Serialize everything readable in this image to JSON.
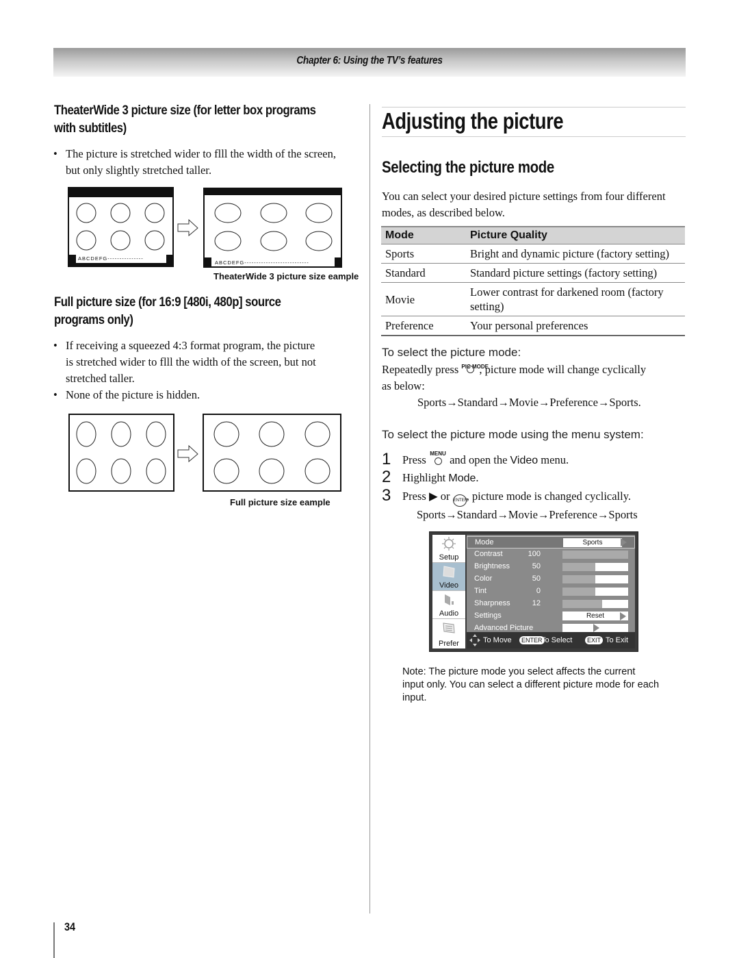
{
  "header": {
    "chapter": "Chapter 6: Using the TV’s features"
  },
  "left": {
    "theaterwide": {
      "heading_line1": "TheaterWide 3 picture size (for letter box programs",
      "heading_line2": "with subtitles)",
      "bullets": [
        {
          "line1": "The picture is stretched wider to flll the width of the screen,",
          "line2": "but only slightly stretched taller."
        }
      ],
      "subtitle_sample": "ABCDEFG---------------",
      "subtitle_sample_wide": "ABCDEFG---------------------------",
      "caption": "TheaterWide 3 picture size eample"
    },
    "full": {
      "heading_line1": "Full picture size (for 16:9 [480i, 480p] source",
      "heading_line2": "programs only)",
      "bullets": [
        {
          "line1": "If receiving a squeezed 4:3 format program, the picture",
          "line2": "is stretched wider to flll the width of the screen, but not",
          "line3": "stretched taller."
        },
        {
          "line1": "None of the picture is hidden."
        }
      ],
      "caption": "Full picture size eample"
    }
  },
  "right": {
    "title": "Adjusting the picture",
    "section": "Selecting the picture mode",
    "intro_line1": "You can select your desired picture settings from four different",
    "intro_line2": "modes, as described below.",
    "table": {
      "headers": [
        "Mode",
        "Picture Quality"
      ],
      "rows": [
        {
          "mode": "Sports",
          "quality": "Bright and dynamic picture (factory setting)"
        },
        {
          "mode": "Standard",
          "quality": "Standard picture settings (factory setting)"
        },
        {
          "mode": "Movie",
          "quality": "Lower contrast for darkened room (factory setting)"
        },
        {
          "mode": "Preference",
          "quality": "Your personal preferences"
        }
      ]
    },
    "select_heading": "To select the picture mode:",
    "select_text_a": "Repeatedly press",
    "pic_mode_button": "PIC MODE",
    "select_text_b": ", picture mode will change cyclically",
    "select_text_c": "as below:",
    "cycle1": "Sports→Standard→Movie→Preference→Sports.",
    "menu_heading": "To select the picture mode using the menu system:",
    "steps": [
      {
        "num": "1",
        "a": "Press",
        "button": "MENU",
        "b": "and open the",
        "ui": "Video",
        "c": "menu."
      },
      {
        "num": "2",
        "a": "Highlight",
        "ui": "Mode",
        "c": "."
      },
      {
        "num": "3",
        "a": "Press ▶ or",
        "button": "ENTER",
        "c": ", picture mode is changed cyclically."
      }
    ],
    "cycle2": "Sports→Standard→Movie→Preference→Sports",
    "tv_menu": {
      "side": [
        {
          "label": "Setup",
          "icon": "sun-icon",
          "active": false
        },
        {
          "label": "Video",
          "icon": "screen-icon",
          "active": true
        },
        {
          "label": "Audio",
          "icon": "speaker-icon",
          "active": false
        },
        {
          "label": "Prefer",
          "icon": "document-icon",
          "active": false
        }
      ],
      "mode_label": "Mode",
      "mode_value": "Sports",
      "sliders": [
        {
          "label": "Contrast",
          "value": "100",
          "fraction": 1.0
        },
        {
          "label": "Brightness",
          "value": "50",
          "fraction": 0.5
        },
        {
          "label": "Color",
          "value": "50",
          "fraction": 0.5
        },
        {
          "label": "Tint",
          "value": "0",
          "fraction": 0.5
        },
        {
          "label": "Sharpness",
          "value": "12",
          "fraction": 0.6
        }
      ],
      "settings_label": "Settings",
      "settings_value": "Reset",
      "advanced_label": "Advanced Picture",
      "footer": {
        "move": "To Move",
        "enter_btn": "ENTER",
        "select": "To Select",
        "exit_btn": "EXIT",
        "exit": "To Exit"
      }
    },
    "note_line1": "Note: The picture mode you select affects the current",
    "note_line2": "input only. You can select a different picture mode for each",
    "note_line3": "input."
  },
  "footer": {
    "page_number": "34"
  }
}
